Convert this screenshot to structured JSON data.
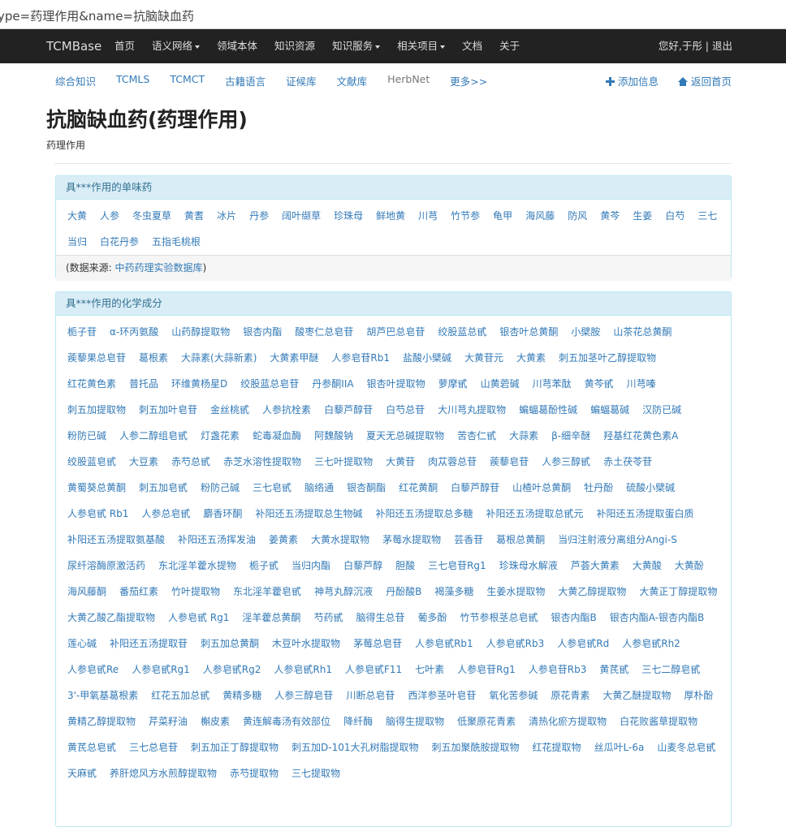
{
  "address_bar": {
    "url": "ype=药理作用&name=抗脑缺血药"
  },
  "navbar": {
    "brand": "TCMBase",
    "items": [
      {
        "label": "首页",
        "dropdown": false
      },
      {
        "label": "语义网络",
        "dropdown": true
      },
      {
        "label": "领域本体",
        "dropdown": false
      },
      {
        "label": "知识资源",
        "dropdown": false
      },
      {
        "label": "知识服务",
        "dropdown": true
      },
      {
        "label": "相关项目",
        "dropdown": true
      },
      {
        "label": "文档",
        "dropdown": false
      },
      {
        "label": "关于",
        "dropdown": false
      }
    ],
    "user_text": "您好,于彤 | 退出"
  },
  "subnav": {
    "items": [
      "综合知识",
      "TCMLS",
      "TCMCT",
      "古籍语言",
      "证候库",
      "文献库",
      "HerbNet",
      "更多>>"
    ],
    "add_info": "添加信息",
    "back_home": "返回首页"
  },
  "page": {
    "title": "抗脑缺血药(药理作用)",
    "subtitle": "药理作用"
  },
  "panel_herbs": {
    "heading": "具***作用的单味药",
    "items": [
      "大黄",
      "人参",
      "冬虫夏草",
      "黄耆",
      "冰片",
      "丹参",
      "阔叶缬草",
      "珍珠母",
      "鲜地黄",
      "川芎",
      "竹节参",
      "龟甲",
      "海风藤",
      "防风",
      "黄芩",
      "生姜",
      "白芍",
      "三七",
      "当归",
      "白花丹参",
      "五指毛桃根"
    ],
    "source_prefix": "(数据来源: ",
    "source_link": "中药药理实验数据库",
    "source_suffix": ")"
  },
  "panel_compounds": {
    "heading": "具***作用的化学成分",
    "items": [
      "栀子苷",
      "α-环丙氨酸",
      "山药醇提取物",
      "银杏内酯",
      "酸枣仁总皂苷",
      "胡芦巴总皂苷",
      "绞股蓝总甙",
      "银杏叶总黄酮",
      "小檗胺",
      "山茶花总黄酮",
      "蒺藜果总皂苷",
      "葛根素",
      "大蒜素(大蒜新素)",
      "大黄素甲醚",
      "人参皂苷Rb1",
      "盐酸小檗碱",
      "大黄苷元",
      "大黄素",
      "刺五加茎叶乙醇提取物",
      "红花黄色素",
      "普托品",
      "环维黄杨星D",
      "绞股蓝总皂苷",
      "丹参酮IIA",
      "银杏叶提取物",
      "萝摩甙",
      "山黄菪碱",
      "川芎苯酞",
      "黄芩甙",
      "川芎嗪",
      "刺五加提取物",
      "刺五加叶皂苷",
      "金丝桃甙",
      "人参抗栓素",
      "白藜芦醇苷",
      "白芍总苷",
      "大川芎丸提取物",
      "蝙蝠葛酚性碱",
      "蝙蝠葛碱",
      "汉防已碱",
      "粉防已碱",
      "人参二醇组皂甙",
      "灯盏花素",
      "蛇毒凝血酶",
      "阿魏酸钠",
      "夏天无总碱提取物",
      "苦杏仁甙",
      "大蒜素",
      "β-细辛醚",
      "羟基红花黄色素A",
      "绞股蓝皂甙",
      "大豆素",
      "赤芍总甙",
      "赤芝水溶性提取物",
      "三七叶提取物",
      "大黄苷",
      "肉苁蓉总苷",
      "蒺藜皂苷",
      "人参三醇甙",
      "赤土茯苓苷",
      "黄蜀葵总黄酮",
      "刺五加皂甙",
      "粉防己碱",
      "三七皂甙",
      "脑络通",
      "银杏酮酯",
      "红花黄酮",
      "白藜芦醇苷",
      "山楂叶总黄酮",
      "牡丹酚",
      "硫酸小檗碱",
      "人参皂甙 Rb1",
      "人参总皂甙",
      "麝香环酮",
      "补阳还五汤提取总生物碱",
      "补阳还五汤提取总多糖",
      "补阳还五汤提取总甙元",
      "补阳还五汤提取蛋白质",
      "补阳还五汤提取氨基酸",
      "补阳还五汤挥发油",
      "姜黄素",
      "大黄水提取物",
      "茅莓水提取物",
      "芸香苷",
      "葛根总黄酮",
      "当归注射液分离组分Angi-S",
      "尿纤溶酶原激活药",
      "东北淫羊藿水提物",
      "栀子甙",
      "当归内酯",
      "白藜芦醇",
      "胆酸",
      "三七皂苷Rg1",
      "珍珠母水解液",
      "芦荟大黄素",
      "大黄酸",
      "大黄酚",
      "海风藤酮",
      "番茄红素",
      "竹叶提取物",
      "东北淫羊藿皂甙",
      "神芎丸醇沉液",
      "丹酚酸B",
      "褐藻多糖",
      "生姜水提取物",
      "大黄乙醇提取物",
      "大黄正丁醇提取物",
      "大黄乙酸乙酯提取物",
      "人参皂甙 Rg1",
      "淫羊藿总黄酮",
      "芍药甙",
      "脑得生总苷",
      "葡多酚",
      "竹节参根茎总皂甙",
      "银杏内酯B",
      "银杏内酯A-银杏内酯B",
      "莲心碱",
      "补阳还五汤提取苷",
      "刺五加总黄酮",
      "木豆叶水提取物",
      "茅莓总皂苷",
      "人参皂甙Rb1",
      "人参皂甙Rb3",
      "人参皂甙Rd",
      "人参皂甙Rh2",
      "人参皂甙Re",
      "人参皂甙Rg1",
      "人参皂甙Rg2",
      "人参皂甙Rh1",
      "人参皂甙F11",
      "七叶素",
      "人参皂苷Rg1",
      "人参皂苷Rb3",
      "黄芪甙",
      "三七二醇皂甙",
      "3'-甲氧基葛根素",
      "红花五加总甙",
      "黄精多糖",
      "人参三醇皂苷",
      "川断总皂苷",
      "西洋参茎叶皂苷",
      "氧化苦参碱",
      "原花青素",
      "大黄乙醚提取物",
      "厚朴酚",
      "黄精乙醇提取物",
      "芹菜籽油",
      "槲皮素",
      "黄连解毒汤有效部位",
      "降纤酶",
      "脑得生提取物",
      "低聚原花青素",
      "清热化瘀方提取物",
      "白花败酱草提取物",
      "黄芪总皂甙",
      "三七总皂苷",
      "刺五加正丁醇提取物",
      "刺五加D-101大孔树脂提取物",
      "刺五加聚酰胺提取物",
      "红花提取物",
      "丝瓜叶L-6a",
      "山麦冬总皂甙",
      "天麻甙",
      "养肝熄风方水煎醇提取物",
      "赤芍提取物",
      "三七提取物"
    ]
  }
}
